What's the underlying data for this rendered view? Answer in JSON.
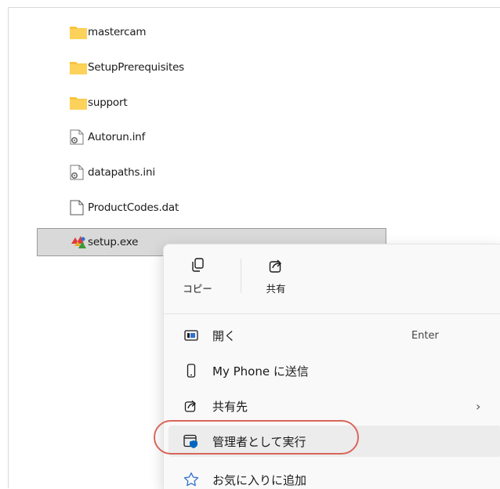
{
  "files": [
    {
      "name": "mastercam",
      "icon": "folder-icon"
    },
    {
      "name": "SetupPrerequisites",
      "icon": "folder-icon"
    },
    {
      "name": "support",
      "icon": "folder-icon"
    },
    {
      "name": "Autorun.inf",
      "icon": "settings-file-icon"
    },
    {
      "name": "datapaths.ini",
      "icon": "settings-file-icon"
    },
    {
      "name": "ProductCodes.dat",
      "icon": "file-icon"
    },
    {
      "name": "setup.exe",
      "icon": "setup-exe-icon",
      "selected": true
    }
  ],
  "context_menu": {
    "quick_actions": [
      {
        "label": "コピー",
        "icon": "copy-icon"
      },
      {
        "label": "共有",
        "icon": "share-icon"
      }
    ],
    "items": [
      {
        "label": "開く",
        "shortcut": "Enter",
        "icon": "open-icon"
      },
      {
        "label": "My Phone に送信",
        "icon": "phone-icon"
      },
      {
        "label": "共有先",
        "icon": "share-icon",
        "submenu": true
      },
      {
        "label": "管理者として実行",
        "icon": "admin-shield-icon",
        "highlighted": true
      },
      {
        "label": "お気に入りに追加",
        "icon": "star-icon"
      }
    ]
  },
  "colors": {
    "folder": "#f8c43a",
    "selection": "#d9d9d9",
    "highlight_ring": "#d9655a",
    "accent": "#0067c0"
  }
}
